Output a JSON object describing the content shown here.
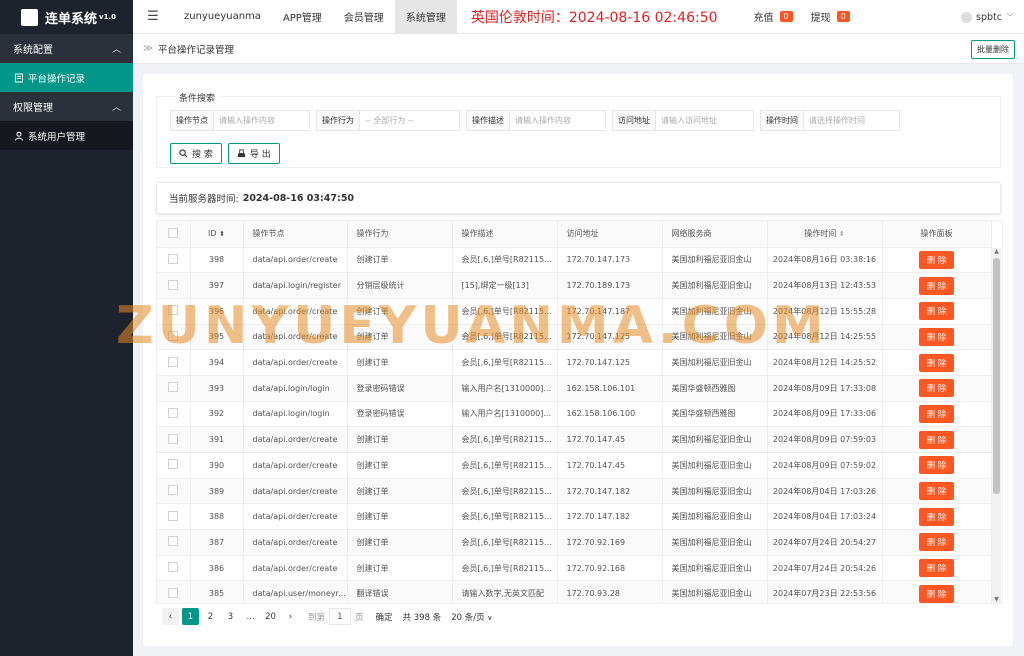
{
  "app": {
    "name": "连单系统",
    "version": "v1.0"
  },
  "sidebar": [
    {
      "group": "系统配置",
      "items": [
        {
          "label": "平台操作记录",
          "icon": "document-icon",
          "active": true
        }
      ]
    },
    {
      "group": "权限管理",
      "items": [
        {
          "label": "系统用户管理",
          "icon": "user-icon",
          "active": false
        }
      ]
    }
  ],
  "topnav": {
    "tabs": [
      "zunyueyuanma",
      "APP管理",
      "会员管理",
      "系统管理"
    ],
    "active": "系统管理",
    "clock": "英国伦敦时间：2024-08-16 02:46:50",
    "recharge": {
      "label": "充值",
      "count": "0"
    },
    "withdraw": {
      "label": "提现",
      "count": "0"
    },
    "username": "spbtc"
  },
  "breadcrumb": "平台操作记录管理",
  "bulk_delete": "批量删除",
  "search": {
    "legend": "条件搜索",
    "fields": [
      {
        "label": "操作节点",
        "placeholder": "请输入操作内容"
      },
      {
        "label": "操作行为",
        "placeholder": "-- 全部行为 --"
      },
      {
        "label": "操作描述",
        "placeholder": "请输入操作内容"
      },
      {
        "label": "访问地址",
        "placeholder": "请输入访问地址"
      },
      {
        "label": "操作时间",
        "placeholder": "请选择操作时间"
      }
    ],
    "search_button": "搜 索",
    "export_button": "导 出"
  },
  "server_time": {
    "label": "当前服务器时间:",
    "value": "2024-08-16 03:47:50"
  },
  "table": {
    "columns": [
      "ID",
      "操作节点",
      "操作行为",
      "操作描述",
      "访问地址",
      "网络服务商",
      "操作时间",
      "操作面板"
    ],
    "delete_label": "删 除",
    "rows": [
      [
        "398",
        "data/api.order/create",
        "创建订单",
        "会员[,6,]单号[R82115...",
        "172.70.147.173",
        "美国加利福尼亚旧金山",
        "2024年08月16日 03:38:16"
      ],
      [
        "397",
        "data/api.login/register",
        "分销层级统计",
        "[15],绑定一级[13]",
        "172.70.189.173",
        "美国加利福尼亚旧金山",
        "2024年08月13日 12:43:53"
      ],
      [
        "396",
        "data/api.order/create",
        "创建订单",
        "会员[,6,]单号[R82115...",
        "172.70.147.187",
        "美国加利福尼亚旧金山",
        "2024年08月12日 15:55:28"
      ],
      [
        "395",
        "data/api.order/create",
        "创建订单",
        "会员[,6,]单号[R82115...",
        "172.70.147.125",
        "美国加利福尼亚旧金山",
        "2024年08月12日 14:25:55"
      ],
      [
        "394",
        "data/api.order/create",
        "创建订单",
        "会员[,6,]单号[R82115...",
        "172.70.147.125",
        "美国加利福尼亚旧金山",
        "2024年08月12日 14:25:52"
      ],
      [
        "393",
        "data/api.login/login",
        "登录密码错误",
        "输入用户名[1310000]...",
        "162.158.106.101",
        "美国华盛顿西雅图",
        "2024年08月09日 17:33:08"
      ],
      [
        "392",
        "data/api.login/login",
        "登录密码错误",
        "输入用户名[1310000]...",
        "162.158.106.100",
        "美国华盛顿西雅图",
        "2024年08月09日 17:33:06"
      ],
      [
        "391",
        "data/api.order/create",
        "创建订单",
        "会员[,6,]单号[R82115...",
        "172.70.147.45",
        "美国加利福尼亚旧金山",
        "2024年08月09日 07:59:03"
      ],
      [
        "390",
        "data/api.order/create",
        "创建订单",
        "会员[,6,]单号[R82115...",
        "172.70.147.45",
        "美国加利福尼亚旧金山",
        "2024年08月09日 07:59:02"
      ],
      [
        "389",
        "data/api.order/create",
        "创建订单",
        "会员[,6,]单号[R82115...",
        "172.70.147.182",
        "美国加利福尼亚旧金山",
        "2024年08月04日 17:03:26"
      ],
      [
        "388",
        "data/api.order/create",
        "创建订单",
        "会员[,6,]单号[R82115...",
        "172.70.147.182",
        "美国加利福尼亚旧金山",
        "2024年08月04日 17:03:24"
      ],
      [
        "387",
        "data/api.order/create",
        "创建订单",
        "会员[,6,]单号[R82115...",
        "172.70.92.169",
        "美国加利福尼亚旧金山",
        "2024年07月24日 20:54:27"
      ],
      [
        "386",
        "data/api.order/create",
        "创建订单",
        "会员[,6,]单号[R82115...",
        "172.70.92.168",
        "美国加利福尼亚旧金山",
        "2024年07月24日 20:54:26"
      ],
      [
        "385",
        "data/api.user/moneyr...",
        "翻译错误",
        "请输入数字,无英文匹配",
        "172.70.93.28",
        "美国加利福尼亚旧金山",
        "2024年07月23日 22:53:56"
      ]
    ]
  },
  "pagination": {
    "pages": [
      "1",
      "2",
      "3"
    ],
    "ellipsis": "...",
    "last": "20",
    "goto_label": "到第",
    "goto_value": "1",
    "page_unit": "页",
    "confirm": "确定",
    "total": "共 398 条",
    "per_page": "20 条/页"
  },
  "watermark": "ZUNYUEYUANMA.COM",
  "colors": {
    "accent": "#009688",
    "danger": "#ff5722",
    "clock": "#e02020",
    "sidebar": "#1e222d"
  }
}
